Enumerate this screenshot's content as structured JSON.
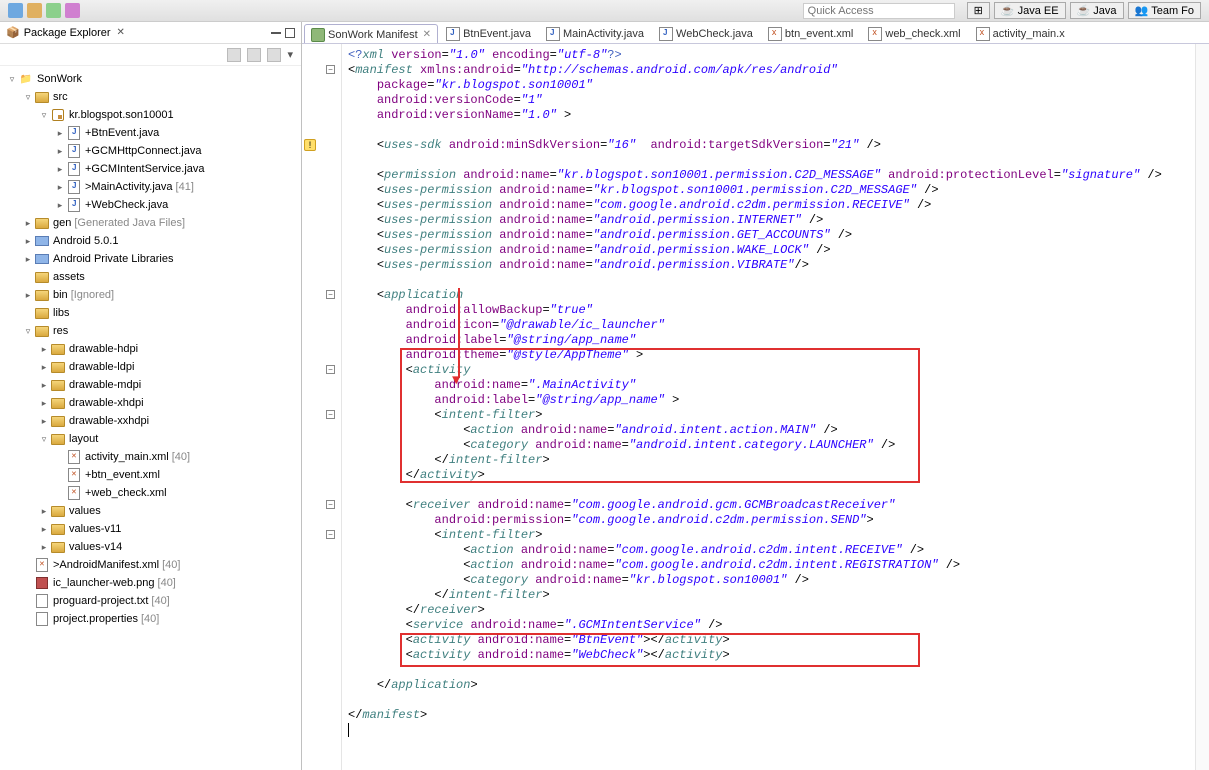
{
  "quickAccess": {
    "placeholder": "Quick Access"
  },
  "perspectives": [
    {
      "label": "Java EE",
      "icon": "javaee-icon"
    },
    {
      "label": "Java",
      "icon": "java-icon"
    },
    {
      "label": "Team Fo",
      "icon": "team-icon"
    }
  ],
  "explorer": {
    "title": "Package Explorer",
    "project": "SonWork",
    "src": "src",
    "pkg": "kr.blogspot.son10001",
    "javaFiles": [
      {
        "name": "+BtnEvent.java"
      },
      {
        "name": "+GCMHttpConnect.java"
      },
      {
        "name": "+GCMIntentService.java"
      },
      {
        "name": ">MainActivity.java",
        "deco": "[41]"
      },
      {
        "name": "+WebCheck.java"
      }
    ],
    "gen": "gen",
    "genDeco": "[Generated Java Files]",
    "android": "Android 5.0.1",
    "privLib": "Android Private Libraries",
    "assets": "assets",
    "bin": "bin",
    "binDeco": "[Ignored]",
    "libs": "libs",
    "res": "res",
    "resFolders": [
      "drawable-hdpi",
      "drawable-ldpi",
      "drawable-mdpi",
      "drawable-xhdpi",
      "drawable-xxhdpi"
    ],
    "layout": "layout",
    "layoutFiles": [
      {
        "name": "activity_main.xml",
        "deco": "[40]"
      },
      {
        "name": "+btn_event.xml"
      },
      {
        "name": "+web_check.xml"
      }
    ],
    "values": [
      "values",
      "values-v11",
      "values-v14"
    ],
    "rootFiles": [
      {
        "name": ">AndroidManifest.xml",
        "deco": "[40]",
        "icon": "manifest"
      },
      {
        "name": "ic_launcher-web.png",
        "deco": "[40]",
        "icon": "img"
      },
      {
        "name": "proguard-project.txt",
        "deco": "[40]",
        "icon": "txt"
      },
      {
        "name": "project.properties",
        "deco": "[40]",
        "icon": "txt"
      }
    ]
  },
  "tabs": [
    {
      "label": "SonWork Manifest",
      "active": true,
      "icon": "manifest"
    },
    {
      "label": "BtnEvent.java",
      "icon": "j"
    },
    {
      "label": "MainActivity.java",
      "icon": "j"
    },
    {
      "label": "WebCheck.java",
      "icon": "j"
    },
    {
      "label": "btn_event.xml",
      "icon": "x"
    },
    {
      "label": "web_check.xml",
      "icon": "x"
    },
    {
      "label": "activity_main.x",
      "icon": "x"
    }
  ],
  "xml": {
    "decl": "<?xml version=\"1.0\" encoding=\"utf-8\"?>",
    "manifestNs": "http://schemas.android.com/apk/res/android",
    "package": "kr.blogspot.son10001",
    "versionCode": "1",
    "versionName": "1.0",
    "minSdk": "16",
    "targetSdk": "21",
    "permName": "kr.blogspot.son10001.permission.C2D_MESSAGE",
    "protectionLevel": "signature",
    "uses": [
      "kr.blogspot.son10001.permission.C2D_MESSAGE",
      "com.google.android.c2dm.permission.RECEIVE",
      "android.permission.INTERNET",
      "android.permission.GET_ACCOUNTS",
      "android.permission.WAKE_LOCK",
      "android.permission.VIBRATE"
    ],
    "allowBackup": "true",
    "icon": "@drawable/ic_launcher",
    "label": "@string/app_name",
    "theme": "@style/AppTheme",
    "mainActivity": ".MainActivity",
    "actionMain": "android.intent.action.MAIN",
    "catLauncher": "android.intent.category.LAUNCHER",
    "receiverName": "com.google.android.gcm.GCMBroadcastReceiver",
    "receiverPerm": "com.google.android.c2dm.permission.SEND",
    "rcvAction1": "com.google.android.c2dm.intent.RECEIVE",
    "rcvAction2": "com.google.android.c2dm.intent.REGISTRATION",
    "rcvCategory": "kr.blogspot.son10001",
    "serviceName": ".GCMIntentService",
    "actBtnEvent": "BtnEvent",
    "actWebCheck": "WebCheck"
  }
}
